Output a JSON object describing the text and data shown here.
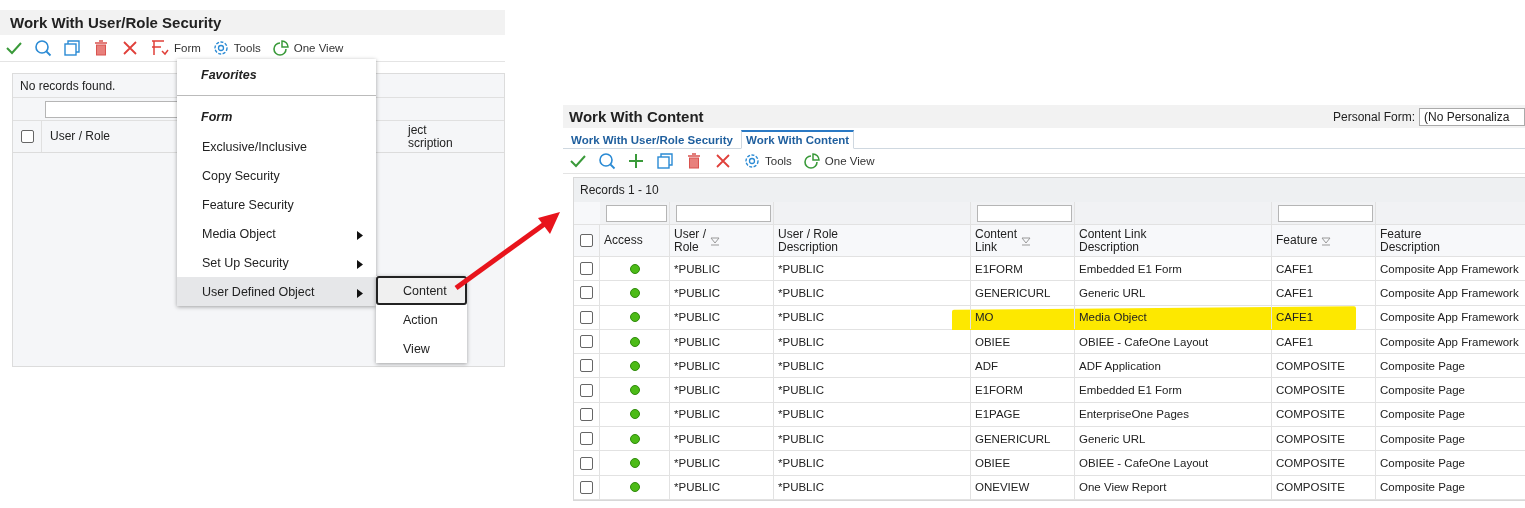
{
  "left_window": {
    "title": "Work With User/Role Security",
    "toolbar": [
      {
        "kind": "ok"
      },
      {
        "kind": "find"
      },
      {
        "kind": "copy"
      },
      {
        "kind": "delete"
      },
      {
        "kind": "close"
      },
      {
        "kind": "form",
        "label": "Form"
      },
      {
        "kind": "tools",
        "label": "Tools"
      },
      {
        "kind": "oneview",
        "label": "One View"
      }
    ],
    "grid": {
      "status": "No records found.",
      "header_checkbox": {
        "checked": false
      },
      "columns": [
        {
          "lines": [
            "User / Role"
          ]
        },
        {
          "lines": [
            "ject",
            "scription"
          ]
        }
      ]
    },
    "menu": {
      "sections": [
        {
          "heading": "Favorites"
        },
        {
          "heading": "Form",
          "items": [
            {
              "label": "Exclusive/Inclusive",
              "submenu": false,
              "selected": false
            },
            {
              "label": "Copy Security",
              "submenu": false,
              "selected": false
            },
            {
              "label": "Feature Security",
              "submenu": false,
              "selected": false
            },
            {
              "label": "Media Object",
              "submenu": true,
              "selected": false
            },
            {
              "label": "Set Up Security",
              "submenu": true,
              "selected": false
            },
            {
              "label": "User Defined Object",
              "submenu": true,
              "selected": true
            }
          ]
        }
      ],
      "submenu": [
        {
          "label": "Content",
          "selected": true
        },
        {
          "label": "Action",
          "selected": false
        },
        {
          "label": "View",
          "selected": false
        }
      ]
    }
  },
  "right_window": {
    "title": "Work With Content",
    "personal_form": {
      "label": "Personal Form:",
      "value": "(No Personaliza"
    },
    "tabs": [
      {
        "label": "Work With User/Role Security",
        "selected": false
      },
      {
        "label": "Work With Content",
        "selected": true
      }
    ],
    "toolbar": [
      {
        "kind": "ok"
      },
      {
        "kind": "find"
      },
      {
        "kind": "add"
      },
      {
        "kind": "copy"
      },
      {
        "kind": "delete"
      },
      {
        "kind": "close"
      },
      {
        "kind": "tools",
        "label": "Tools"
      },
      {
        "kind": "oneview",
        "label": "One View"
      }
    ],
    "grid": {
      "records": "Records 1 - 10",
      "header_checkbox": {
        "checked": false
      },
      "columns": [
        {
          "lines": [
            "Access"
          ],
          "filter": true,
          "sortable": false
        },
        {
          "lines": [
            "User /",
            "Role"
          ],
          "filter": true,
          "sortable": true
        },
        {
          "lines": [
            "User / Role",
            "Description"
          ],
          "filter": false,
          "sortable": false
        },
        {
          "lines": [
            "Content",
            "Link"
          ],
          "filter": true,
          "sortable": true
        },
        {
          "lines": [
            "Content Link",
            "Description"
          ],
          "filter": false,
          "sortable": false
        },
        {
          "lines": [
            "Feature"
          ],
          "filter": true,
          "sortable": true
        },
        {
          "lines": [
            "Feature",
            "Description"
          ],
          "filter": false,
          "sortable": false
        }
      ],
      "rows": [
        {
          "checked": false,
          "highlighted": false,
          "cells": [
            "",
            "*PUBLIC",
            "*PUBLIC",
            "E1FORM",
            "Embedded E1 Form",
            "CAFE1",
            "Composite App Framework"
          ]
        },
        {
          "checked": false,
          "highlighted": false,
          "cells": [
            "",
            "*PUBLIC",
            "*PUBLIC",
            "GENERICURL",
            "Generic URL",
            "CAFE1",
            "Composite App Framework"
          ]
        },
        {
          "checked": false,
          "highlighted": true,
          "cells": [
            "",
            "*PUBLIC",
            "*PUBLIC",
            "MO",
            "Media Object",
            "CAFE1",
            "Composite App Framework"
          ]
        },
        {
          "checked": false,
          "highlighted": false,
          "cells": [
            "",
            "*PUBLIC",
            "*PUBLIC",
            "OBIEE",
            "OBIEE - CafeOne Layout",
            "CAFE1",
            "Composite App Framework"
          ]
        },
        {
          "checked": false,
          "highlighted": false,
          "cells": [
            "",
            "*PUBLIC",
            "*PUBLIC",
            "ADF",
            "ADF Application",
            "COMPOSITE",
            "Composite Page"
          ]
        },
        {
          "checked": false,
          "highlighted": false,
          "cells": [
            "",
            "*PUBLIC",
            "*PUBLIC",
            "E1FORM",
            "Embedded E1 Form",
            "COMPOSITE",
            "Composite Page"
          ]
        },
        {
          "checked": false,
          "highlighted": false,
          "cells": [
            "",
            "*PUBLIC",
            "*PUBLIC",
            "E1PAGE",
            "EnterpriseOne Pages",
            "COMPOSITE",
            "Composite Page"
          ]
        },
        {
          "checked": false,
          "highlighted": false,
          "cells": [
            "",
            "*PUBLIC",
            "*PUBLIC",
            "GENERICURL",
            "Generic URL",
            "COMPOSITE",
            "Composite Page"
          ]
        },
        {
          "checked": false,
          "highlighted": false,
          "cells": [
            "",
            "*PUBLIC",
            "*PUBLIC",
            "OBIEE",
            "OBIEE - CafeOne Layout",
            "COMPOSITE",
            "Composite Page"
          ]
        },
        {
          "checked": false,
          "highlighted": false,
          "cells": [
            "",
            "*PUBLIC",
            "*PUBLIC",
            "ONEVIEW",
            "One View Report",
            "COMPOSITE",
            "Composite Page"
          ]
        }
      ]
    }
  }
}
